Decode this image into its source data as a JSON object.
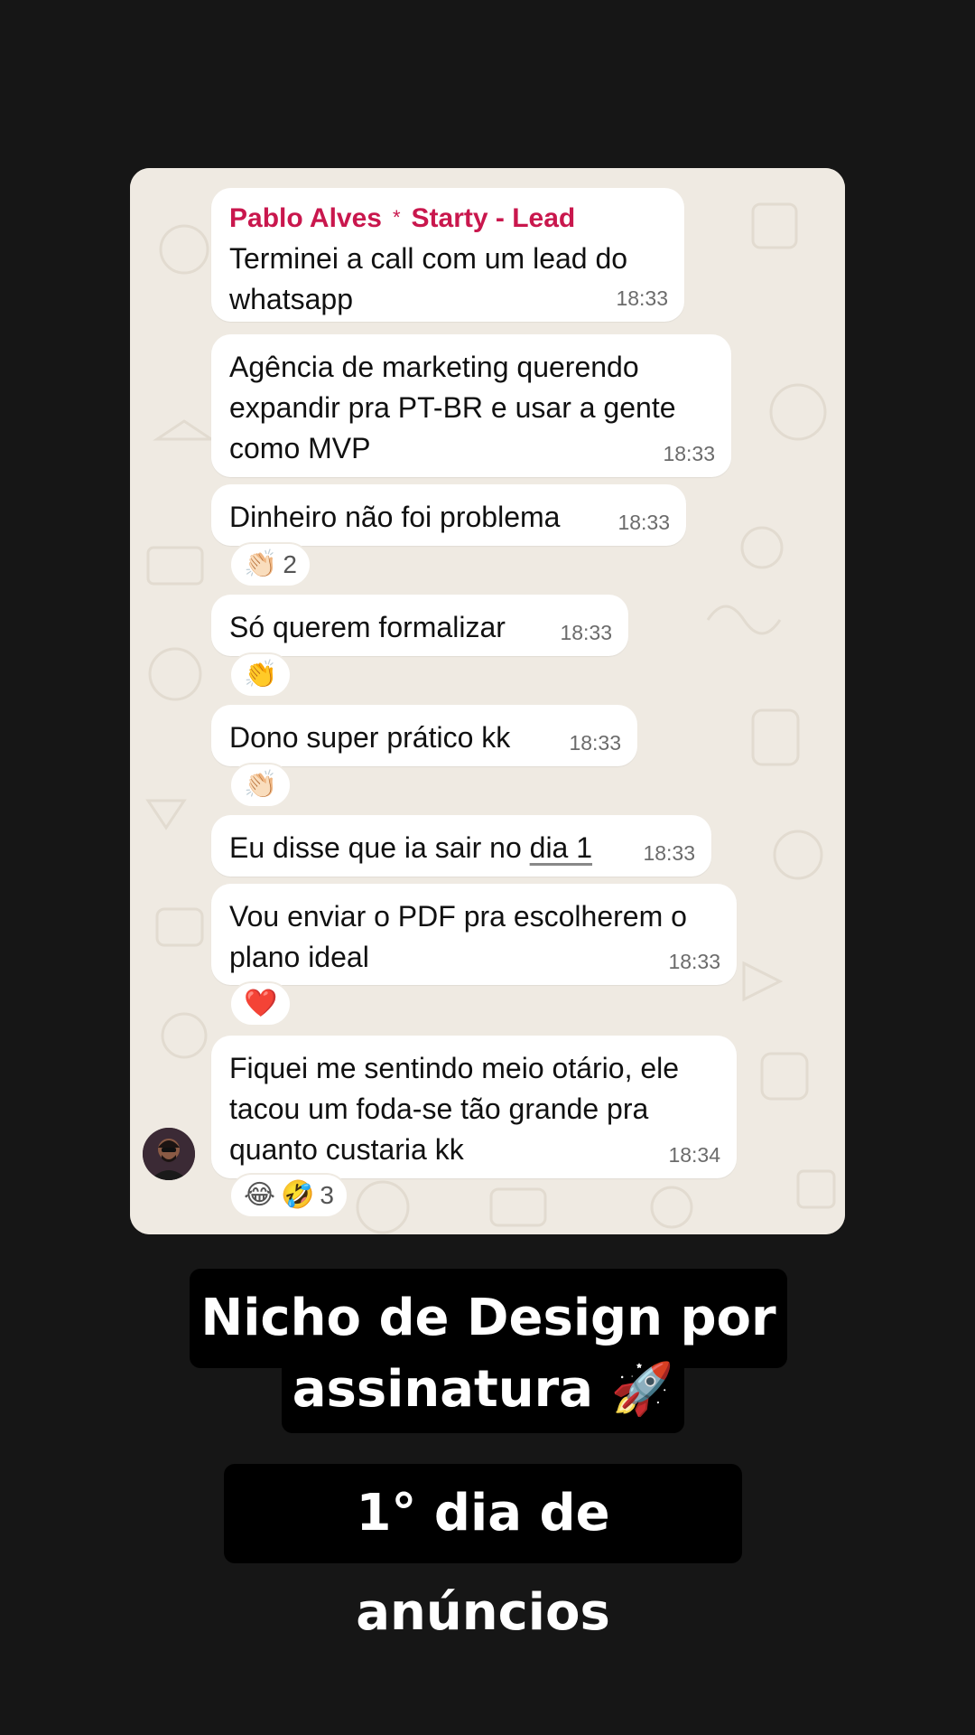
{
  "chat": {
    "header_sender": "Pablo Alves",
    "header_separator": "*",
    "header_group": "Starty - Lead",
    "messages": [
      {
        "text": "Terminei a call com um lead do\nwhatsapp",
        "time": "18:33"
      },
      {
        "text": "Agência de marketing querendo\nexpandir pra PT-BR e usar a gente\ncomo MVP",
        "time": "18:33"
      },
      {
        "text": "Dinheiro não foi problema",
        "time": "18:33",
        "reaction_emoji": "👏🏻",
        "reaction_count": "2"
      },
      {
        "text": "Só querem formalizar",
        "time": "18:33",
        "reaction_emoji": "👏"
      },
      {
        "text": "Dono super prático kk",
        "time": "18:33",
        "reaction_emoji": "👏🏻"
      },
      {
        "text_prefix": "Eu disse que ia sair no ",
        "text_link": "dia 1",
        "time": "18:33"
      },
      {
        "text": "Vou enviar o PDF pra escolherem o\nplano ideal",
        "time": "18:33",
        "reaction_emoji": "❤️"
      },
      {
        "text": "Fiquei me sentindo meio otário, ele\ntacou um foda-se tão grande pra\nquanto custaria kk",
        "time": "18:34",
        "reaction_emoji": "😂",
        "reaction_emoji_2": "🤣",
        "reaction_count": "3"
      }
    ]
  },
  "captions": {
    "line1": "Nicho de Design por",
    "line2": "assinatura 🚀",
    "line3": "1° dia de anúncios"
  },
  "colors": {
    "background": "#161616",
    "chat_wallpaper": "#efeae2",
    "sender_name": "#c9174d",
    "bubble": "#ffffff"
  }
}
